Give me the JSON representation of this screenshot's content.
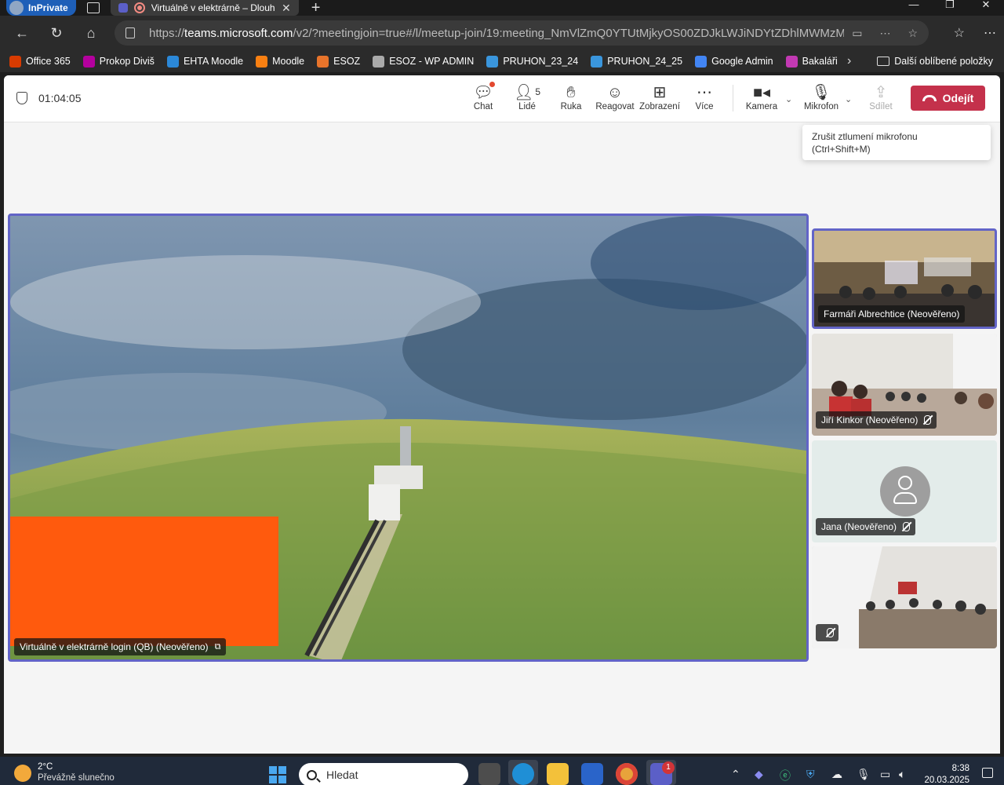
{
  "browser": {
    "inprivate_label": "InPrivate",
    "tab_title": "Virtuálně v elektrárně – Dlouh",
    "url_prefix": "https://",
    "url_host": "teams.microsoft.com",
    "url_rest": "/v2/?meetingjoin=true#/l/meetup-join/19:meeting_NmVlZmQ0YTUtMjkyOS00ZDJkLWJiNDYtZDhlMWMzM...",
    "favorites": [
      {
        "label": "Office 365",
        "color": "#d83b01"
      },
      {
        "label": "Prokop Diviš",
        "color": "#b4009e"
      },
      {
        "label": "EHTA Moodle",
        "color": "#2b88d8"
      },
      {
        "label": "Moodle",
        "color": "#f98012"
      },
      {
        "label": "ESOZ",
        "color": "#e8742b"
      },
      {
        "label": "ESOZ - WP ADMIN",
        "color": "#aaaaaa"
      },
      {
        "label": "PRUHON_23_24",
        "color": "#3a96dd"
      },
      {
        "label": "PRUHON_24_25",
        "color": "#3a96dd"
      },
      {
        "label": "Google Admin",
        "color": "#4285f4"
      },
      {
        "label": "Bakaláři",
        "color": "#c239b3"
      }
    ],
    "other_favorites": "Další oblíbené položky"
  },
  "meeting": {
    "elapsed": "01:04:05",
    "toolbar": {
      "chat": "Chat",
      "people": "Lidé",
      "people_count": "5",
      "raise_hand": "Ruka",
      "react": "Reagovat",
      "view": "Zobrazení",
      "more": "Více",
      "camera": "Kamera",
      "mic": "Mikrofon",
      "share": "Sdílet",
      "leave": "Odejít"
    },
    "tooltip_line1": "Zrušit ztlumení mikrofonu",
    "tooltip_line2": "(Ctrl+Shift+M)",
    "main_participant": "Virtuálně v elektrárně login (QB) (Neověřeno)",
    "participants": [
      {
        "name": "Farmáři Albrechtice (Neověřeno)",
        "speaking": true,
        "muted": false
      },
      {
        "name": "Jiří Kinkor (Neověřeno)",
        "speaking": false,
        "muted": true
      },
      {
        "name": "Jana (Neověřeno)",
        "speaking": false,
        "muted": true
      },
      {
        "name": "",
        "speaking": false,
        "muted": true
      }
    ]
  },
  "taskbar": {
    "temperature": "2°C",
    "condition": "Převážně slunečno",
    "search_placeholder": "Hledat",
    "teams_badge": "1",
    "time": "8:38",
    "date": "20.03.2025"
  },
  "colors": {
    "accent": "#6264c7",
    "leave": "#c4314b",
    "redaction": "#ff5a0d"
  }
}
